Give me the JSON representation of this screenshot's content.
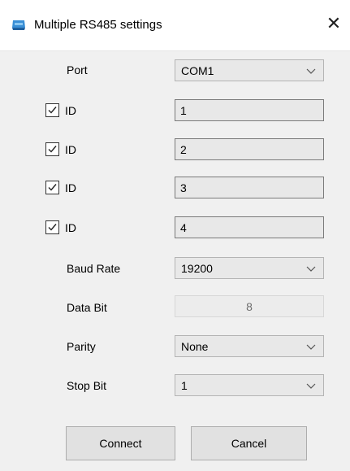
{
  "window": {
    "title": "Multiple RS485 settings",
    "close_glyph": "✕"
  },
  "port": {
    "label": "Port",
    "value": "COM1"
  },
  "ids": [
    {
      "label": "ID",
      "checked": true,
      "value": "1"
    },
    {
      "label": "ID",
      "checked": true,
      "value": "2"
    },
    {
      "label": "ID",
      "checked": true,
      "value": "3"
    },
    {
      "label": "ID",
      "checked": true,
      "value": "4"
    }
  ],
  "baud_rate": {
    "label": "Baud Rate",
    "value": "19200"
  },
  "data_bit": {
    "label": "Data Bit",
    "value": "8",
    "enabled": false
  },
  "parity": {
    "label": "Parity",
    "value": "None"
  },
  "stop_bit": {
    "label": "Stop Bit",
    "value": "1"
  },
  "buttons": {
    "connect": "Connect",
    "cancel": "Cancel"
  },
  "icons": {
    "app": "serial-port-icon",
    "dropdown": "chevron-down-icon",
    "check": "checkmark-icon"
  },
  "colors": {
    "app_icon": "#3a8fd6",
    "field_bg": "#e8e8e8",
    "window_bg": "#f0f0f0"
  }
}
